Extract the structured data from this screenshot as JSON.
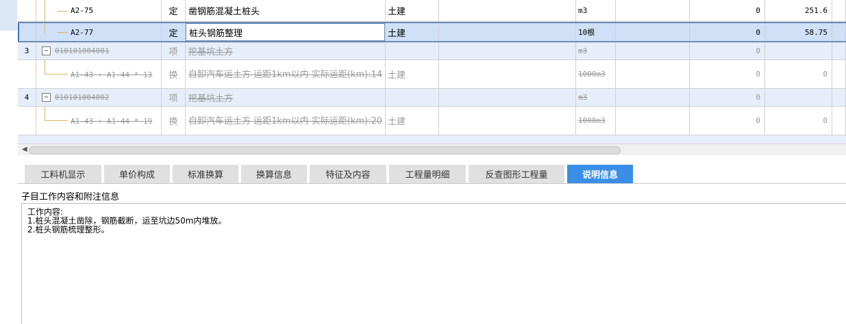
{
  "grid": {
    "rows": [
      {
        "no": "",
        "code": "A2-75",
        "type": "定",
        "name": "凿钢筋混凝土桩头",
        "major": "土建",
        "unit": "m3",
        "qty": "0",
        "price": "251.6",
        "style": "normal"
      },
      {
        "no": "",
        "code": "A2-77",
        "type": "定",
        "name": "桩头钢筋整理",
        "major": "土建",
        "unit": "10根",
        "qty": "0",
        "price": "58.75",
        "style": "selected"
      },
      {
        "no": "3",
        "code": "010101004001",
        "type": "项",
        "name": "挖基坑土方",
        "major": "",
        "unit": "m3",
        "qty": "0",
        "price": "",
        "style": "struck-parent"
      },
      {
        "no": "",
        "code": "A1-43 + A1-44 * 13",
        "type": "换",
        "name": "自卸汽车运土方 运距1km以内  实际运距(km):14",
        "major": "土建",
        "unit": "1000m3",
        "qty": "0",
        "price": "0",
        "style": "struck-child"
      },
      {
        "no": "4",
        "code": "010101004002",
        "type": "项",
        "name": "挖基坑土方",
        "major": "",
        "unit": "m3",
        "qty": "0",
        "price": "",
        "style": "struck-parent"
      },
      {
        "no": "",
        "code": "A1-43 + A1-44 * 19",
        "type": "换",
        "name": "自卸汽车运土方 运距1km以内  实际运距(km):20",
        "major": "土建",
        "unit": "1000m3",
        "qty": "0",
        "price": "0",
        "style": "struck-child"
      }
    ]
  },
  "tabs": [
    {
      "label": "工料机显示",
      "active": false
    },
    {
      "label": "单价构成",
      "active": false
    },
    {
      "label": "标准换算",
      "active": false
    },
    {
      "label": "换算信息",
      "active": false
    },
    {
      "label": "特征及内容",
      "active": false
    },
    {
      "label": "工程量明细",
      "active": false
    },
    {
      "label": "反查图形工程量",
      "active": false
    },
    {
      "label": "说明信息",
      "active": true
    }
  ],
  "panel": {
    "title": "子目工作内容和附注信息",
    "content": "工作内容:\n1.桩头混凝土凿除，钢筋截断，运至坑边50m内堆放。\n2.桩头钢筋梳理整形。"
  },
  "icons": {
    "expander": "collapse-minus-icon",
    "scroll_left": "scroll-left-arrow-icon"
  },
  "colors": {
    "accent": "#3a8ee6",
    "selected_row": "#cfe0f7",
    "disabled_text": "#9a9a9a"
  }
}
